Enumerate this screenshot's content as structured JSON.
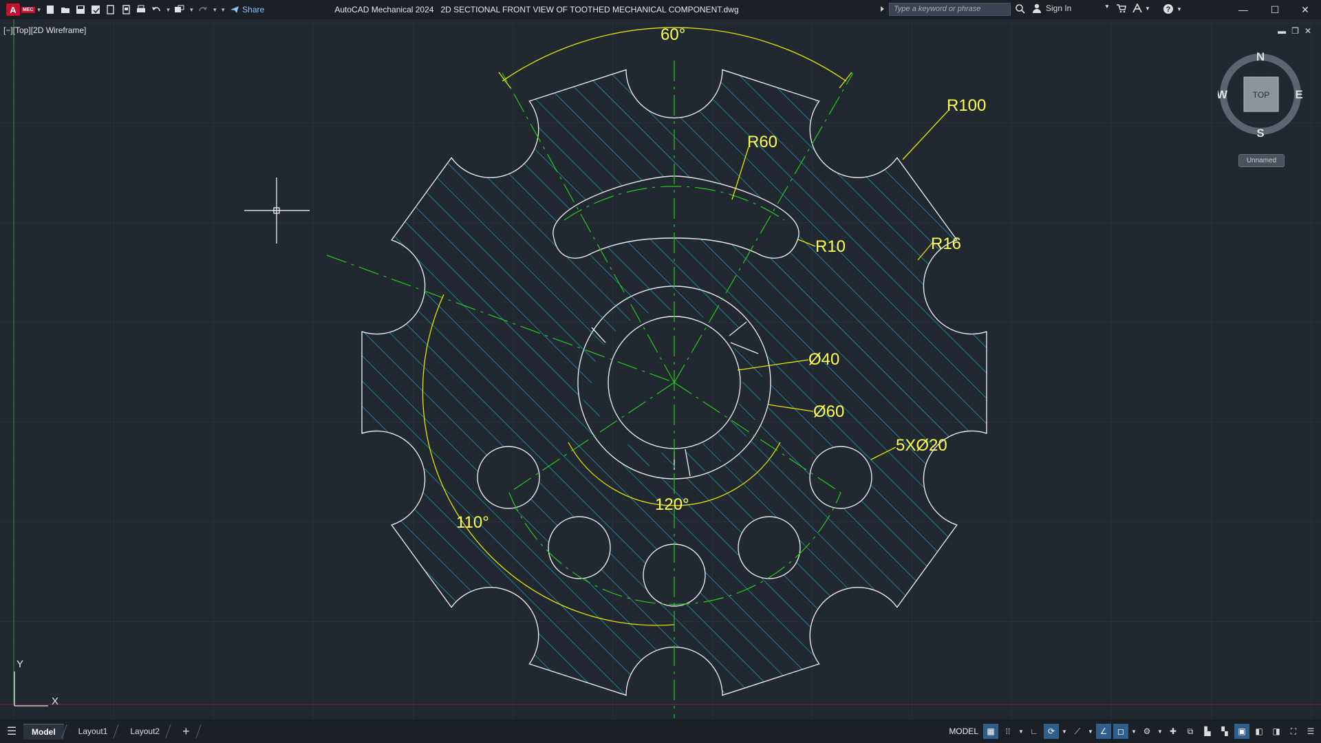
{
  "app": {
    "logo_text": "A",
    "badge_text": "MEC",
    "title": "AutoCAD Mechanical 2024   2D SECTIONAL FRONT VIEW OF TOOTHED MECHANICAL COMPONENT.dwg"
  },
  "toolbar": {
    "share_label": "Share"
  },
  "search": {
    "placeholder": "Type a keyword or phrase"
  },
  "account": {
    "signin_label": "Sign In"
  },
  "viewport": {
    "label": "[−][Top][2D Wireframe]"
  },
  "viewcube": {
    "north": "N",
    "south": "S",
    "east": "E",
    "west": "W",
    "face": "TOP",
    "ucs": "Unnamed"
  },
  "ucs_icon": {
    "x": "X",
    "y": "Y"
  },
  "dimensions": {
    "angle_top": "60°",
    "r100": "R100",
    "r60": "R60",
    "r10": "R10",
    "r16": "R16",
    "d40": "Ø40",
    "d60": "Ø60",
    "holes": "5XØ20",
    "angle_120": "120°",
    "angle_110": "110°"
  },
  "status": {
    "tabs": [
      "Model",
      "Layout1",
      "Layout2"
    ],
    "model_label": "MODEL"
  },
  "colors": {
    "background": "#212830",
    "grid": "#2b323c",
    "outline": "#e8e8e8",
    "hatch": "#1fb3d6",
    "centerline": "#22c91e",
    "dimension": "#e6e600"
  }
}
